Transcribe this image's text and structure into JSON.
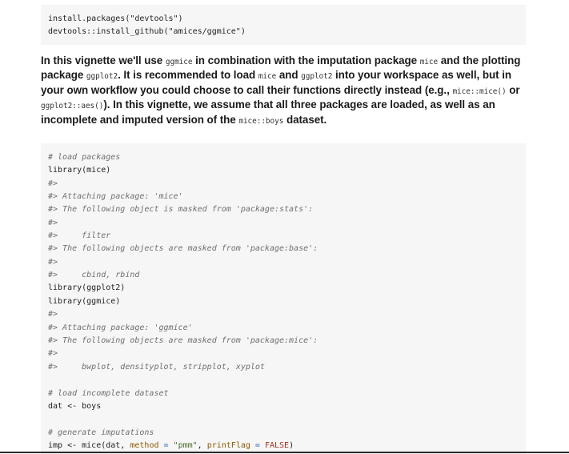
{
  "install_code": {
    "line_1": "install.packages(\"devtools\")",
    "line_2": "devtools::install_github(\"amices/ggmice\")"
  },
  "intro": {
    "t1": "In this vignette we'll use ",
    "c1": "ggmice",
    "t2": " in combination with the imputation package ",
    "c2": "mice",
    "t3": " and the plotting package ",
    "c3": "ggplot2",
    "t4": ". It is recommended to load ",
    "c4": "mice",
    "t5": " and ",
    "c5": "ggplot2",
    "t6": " into your workspace as well, but in your own workflow you could choose to call their functions directly instead (e.g., ",
    "c6": "mice::mice()",
    "t7": " or ",
    "c7": "ggplot2::aes()",
    "t8": "). In this vignette, we assume that all three packages are loaded, as well as an incomplete and imputed version of the ",
    "c8": "mice::boys",
    "t9": " dataset."
  },
  "main_code": {
    "comment_load_packages": "# load packages",
    "library_mice": "library(mice)",
    "out_1": "#>",
    "out_2": "#> Attaching package: 'mice'",
    "out_3": "#> The following object is masked from 'package:stats':",
    "out_4": "#>",
    "out_5": "#>     filter",
    "out_6": "#> The following objects are masked from 'package:base':",
    "out_7": "#>",
    "out_8": "#>     cbind, rbind",
    "library_ggplot2": "library(ggplot2)",
    "library_ggmice": "library(ggmice)",
    "out_9": "#>",
    "out_10": "#> Attaching package: 'ggmice'",
    "out_11": "#> The following objects are masked from 'package:mice':",
    "out_12": "#>",
    "out_13": "#>     bwplot, densityplot, stripplot, xyplot",
    "comment_load_incomplete": "# load incomplete dataset",
    "dat_assign": "dat <- boys",
    "comment_generate": "# generate imputations",
    "imp_prefix": "imp <- mice(dat, ",
    "imp_method_arg": "method",
    "imp_eq1": " = ",
    "imp_method_val": "\"pmm\"",
    "imp_comma": ", ",
    "imp_print_arg": "printFlag",
    "imp_eq2": " = ",
    "imp_print_val": "FALSE",
    "imp_close": ")"
  }
}
